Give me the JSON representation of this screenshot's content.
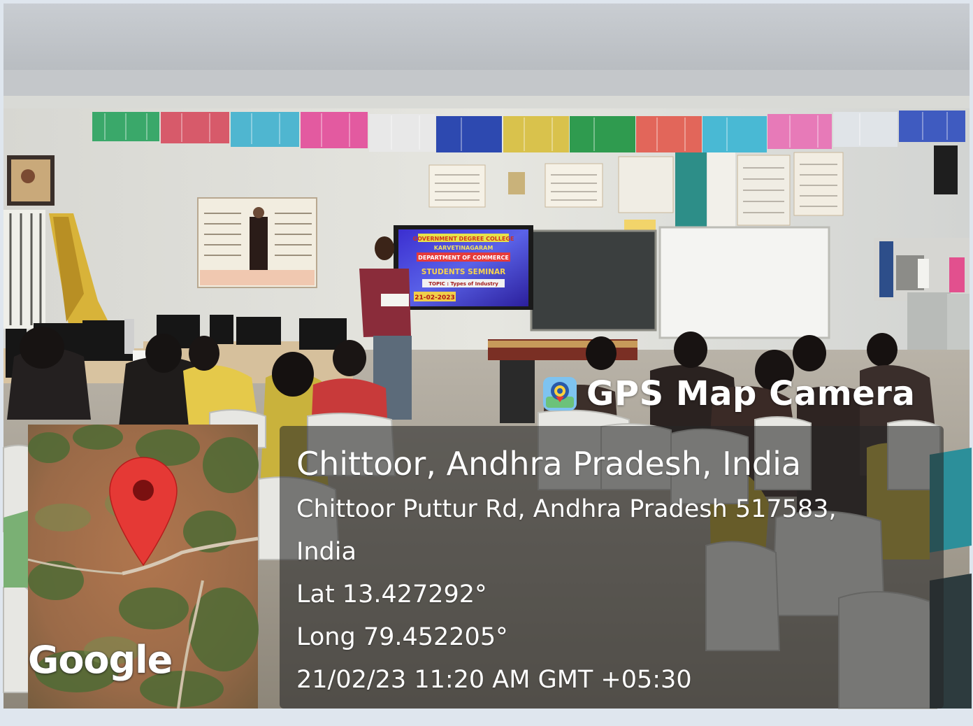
{
  "overlay": {
    "app_name": "GPS Map Camera",
    "location_title": "Chittoor, Andhra Pradesh, India",
    "address_line1": "Chittoor Puttur Rd, Andhra Pradesh 517583,",
    "address_line2": "India",
    "latitude": "Lat 13.427292°",
    "longitude": "Long 79.452205°",
    "datetime": "21/02/23 11:20 AM GMT +05:30"
  },
  "map": {
    "provider_logo_text": "Google",
    "pin_color": "#e53935"
  },
  "projector_slide": {
    "line1": "GOVERNMENT DEGREE COLLEGE",
    "line2": "KARVETINAGARAM",
    "line3": "DEPARTMENT OF COMMERCE",
    "line4": "STUDENTS SEMINAR",
    "line5": "TOPIC : Types of Industry",
    "line6": "21-02-2023"
  },
  "colors": {
    "panel_bg": "rgba(38,38,38,0.58)",
    "overlay_text": "#ffffff",
    "slide_bg": "#2a34c8"
  }
}
